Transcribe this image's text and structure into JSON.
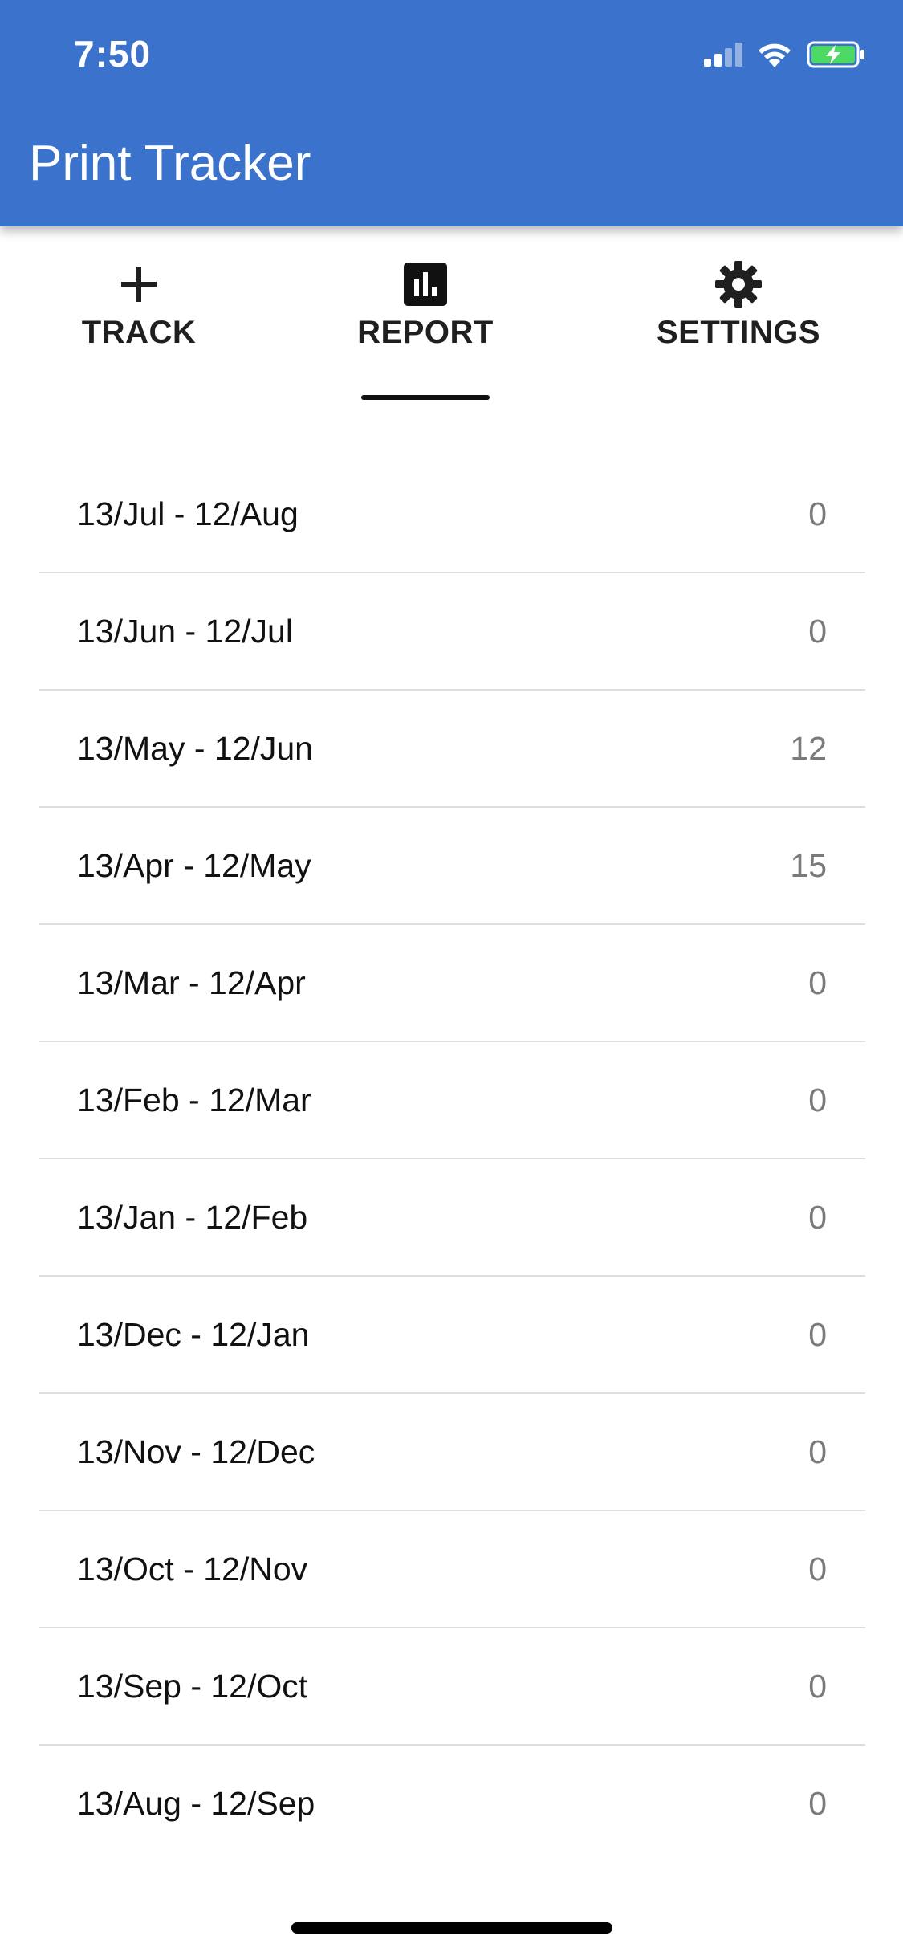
{
  "status_bar": {
    "time": "7:50",
    "icons": [
      "cellular-signal-icon",
      "wifi-icon",
      "battery-charging-icon"
    ],
    "battery_color": "#4CD964"
  },
  "app_bar": {
    "title": "Print Tracker",
    "color": "#3B73CC"
  },
  "tabs": [
    {
      "label": "TRACK",
      "icon": "plus-icon",
      "active": false
    },
    {
      "label": "REPORT",
      "icon": "bar-chart-icon",
      "active": true
    },
    {
      "label": "SETTINGS",
      "icon": "gear-icon",
      "active": false
    }
  ],
  "report": {
    "rows": [
      {
        "range": "13/Jul - 12/Aug",
        "count": "0"
      },
      {
        "range": "13/Jun - 12/Jul",
        "count": "0"
      },
      {
        "range": "13/May - 12/Jun",
        "count": "12"
      },
      {
        "range": "13/Apr - 12/May",
        "count": "15"
      },
      {
        "range": "13/Mar - 12/Apr",
        "count": "0"
      },
      {
        "range": "13/Feb - 12/Mar",
        "count": "0"
      },
      {
        "range": "13/Jan - 12/Feb",
        "count": "0"
      },
      {
        "range": "13/Dec - 12/Jan",
        "count": "0"
      },
      {
        "range": "13/Nov - 12/Dec",
        "count": "0"
      },
      {
        "range": "13/Oct - 12/Nov",
        "count": "0"
      },
      {
        "range": "13/Sep - 12/Oct",
        "count": "0"
      },
      {
        "range": "13/Aug - 12/Sep",
        "count": "0"
      }
    ]
  }
}
